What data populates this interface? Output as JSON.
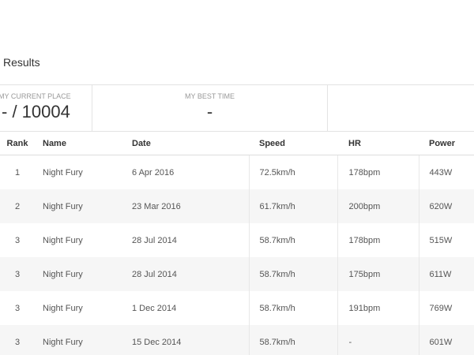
{
  "page": {
    "title": "Results"
  },
  "stats": {
    "current_place_label": "MY CURRENT PLACE",
    "current_place_value": "- / 10004",
    "best_time_label": "MY BEST TIME",
    "best_time_value": "-"
  },
  "table": {
    "headers": {
      "rank": "Rank",
      "name": "Name",
      "date": "Date",
      "speed": "Speed",
      "hr": "HR",
      "power": "Power"
    },
    "rows": [
      {
        "rank": "1",
        "name": "Night Fury",
        "date": "6 Apr 2016",
        "speed": "72.5km/h",
        "hr": "178bpm",
        "power": "443W"
      },
      {
        "rank": "2",
        "name": "Night Fury",
        "date": "23 Mar 2016",
        "speed": "61.7km/h",
        "hr": "200bpm",
        "power": "620W"
      },
      {
        "rank": "3",
        "name": "Night Fury",
        "date": "28 Jul 2014",
        "speed": "58.7km/h",
        "hr": "178bpm",
        "power": "515W"
      },
      {
        "rank": "3",
        "name": "Night Fury",
        "date": "28 Jul 2014",
        "speed": "58.7km/h",
        "hr": "175bpm",
        "power": "611W"
      },
      {
        "rank": "3",
        "name": "Night Fury",
        "date": "1 Dec 2014",
        "speed": "58.7km/h",
        "hr": "191bpm",
        "power": "769W"
      },
      {
        "rank": "3",
        "name": "Night Fury",
        "date": "15 Dec 2014",
        "speed": "58.7km/h",
        "hr": "-",
        "power": "601W"
      }
    ]
  },
  "colors": {
    "link": "#2a8ac4",
    "stripe": "#f6f6f6",
    "border": "#e3e3e3"
  }
}
